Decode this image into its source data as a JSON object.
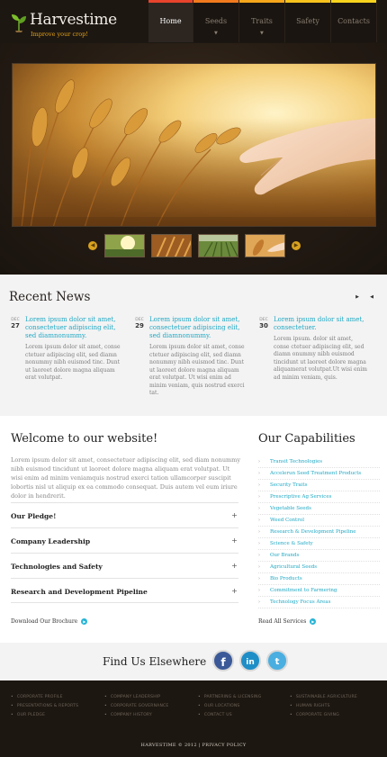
{
  "logo": {
    "title": "Harvestime",
    "tagline": "Improve your crop!"
  },
  "nav": [
    {
      "label": "Home",
      "accent": "#e8432c",
      "has_caret": false
    },
    {
      "label": "Seeds",
      "accent": "#f27a1e",
      "has_caret": true
    },
    {
      "label": "Traits",
      "accent": "#f5a61a",
      "has_caret": true
    },
    {
      "label": "Safety",
      "accent": "#f7c21c",
      "has_caret": false
    },
    {
      "label": "Contacts",
      "accent": "#f7d31d",
      "has_caret": false
    }
  ],
  "slider": {
    "prev_icon": "chevron-left-icon",
    "next_icon": "chevron-right-icon",
    "thumb_count": 4
  },
  "news": {
    "title": "Recent News",
    "items": [
      {
        "month": "DEC",
        "day": "27",
        "headline": "Lorem ipsum dolor sit amet, consectetuer adipiscing elit, sed diamnonummy.",
        "body": "Lorem ipsum dolor sit amet, conse ctetuer adipiscing elit, sed diamn nonummy nibh euismod tinc. Dunt ut laoreet dolore magna aliquam erat volutpat."
      },
      {
        "month": "DEC",
        "day": "29",
        "headline": "Lorem ipsum dolor sit amet, consectetuer adipiscing elit, sed diamnonummy.",
        "body": "Lorem ipsum dolor sit amet, conse ctetuer adipiscing elit, sed diamn nonummy nibh euismod tinc. Dunt ut laoreet dolore magna aliquam erat volutpat. Ut wisi enim ad minim veniam, quis nostrud exerci tat."
      },
      {
        "month": "DEC",
        "day": "30",
        "headline": "Lorem ipsum dolor sit amet, consectetuer.",
        "body": "Lorem ipsum. dolor sit amet, conse ctetuer adipiscing elit, sed diamn onummy nibh euismod tincidunt ut laoreet dolore magna aliquamerat volutpat.Ut wisi enim ad minim veniam, quis."
      }
    ]
  },
  "welcome": {
    "title": "Welcome to our website!",
    "text": "Lorem ipsum dolor sit amet, consectetuer adipiscing elit, sed diam nonummy nibh euismod tincidunt ut laoreet dolore magna aliquam erat volutpat. Ut wisi enim ad minim veniamquis nostrud exerci tation ullamcorper suscipit lobortis nisl ut aliquip ex ea commodo consequat. Duis autem vel eum iriure dolor in hendrerit.",
    "accordion": [
      "Our Pledge!",
      "Company Leadership",
      "Technologies and Safety",
      "Research and Development Pipeline"
    ],
    "more_label": "Download Our Brochure"
  },
  "capabilities": {
    "title": "Our Capabilities",
    "items": [
      "Transit Technologies",
      "Accelerun Seed Treatment Products",
      "Security Traits",
      "Prescriptive Ag Services",
      "Vegetable Seeds",
      "Weed Control",
      "Research & Development Pipeline",
      "Science & Safety",
      "Our Brands",
      "Agricultural Seeds",
      "Bio Products",
      "Commitment to Farmering",
      "Technology Focus Areas"
    ],
    "more_label": "Read All Services"
  },
  "findus": {
    "title": "Find Us Elsewhere",
    "networks": [
      {
        "name": "facebook-icon",
        "glyph": "f",
        "color": "#3b5998"
      },
      {
        "name": "linkedin-icon",
        "glyph": "in",
        "color": "#1f8ec7"
      },
      {
        "name": "twitter-icon",
        "glyph": "t",
        "color": "#4aaee0"
      }
    ]
  },
  "footer": {
    "columns": [
      [
        "CORPORATE PROFILE",
        "PRESENTATIONS & REPORTS",
        "OUR PLEDGE"
      ],
      [
        "COMPANY LEADERSHIP",
        "CORPORATE GOVERNANCE",
        "COMPANY HISTORY"
      ],
      [
        "PARTNERING & LICENSING",
        "OUR LOCATIONS",
        "CONTACT US"
      ],
      [
        "SUSTAINABLE AGRICULTURE",
        "HUMAN RIGHTS",
        "CORPORATE GIVING"
      ]
    ],
    "copyright": "HARVESTIME © 2012 | PRIVACY POLICY"
  },
  "colors": {
    "accent": "#1fa8c4",
    "header_bg": "#1d1712",
    "thumb_arrow": "#d9a21e"
  }
}
